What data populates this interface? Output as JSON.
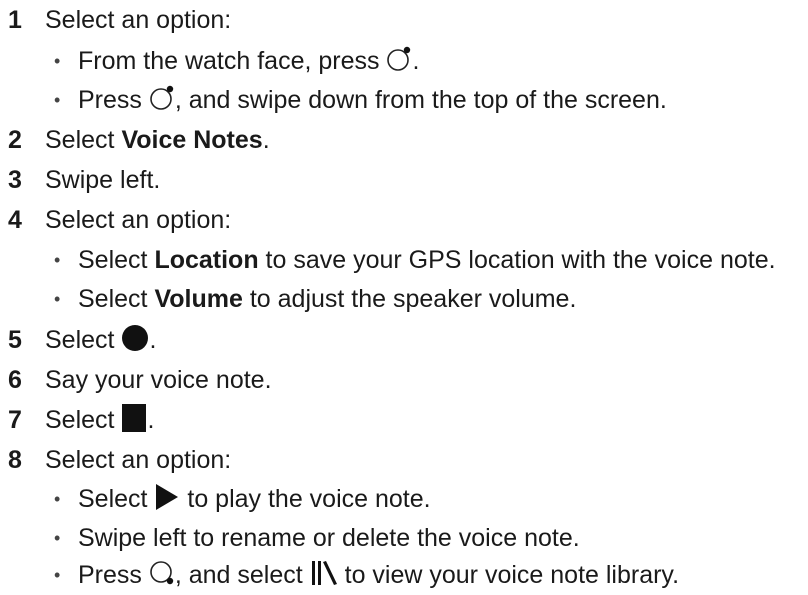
{
  "steps": [
    {
      "number": "1",
      "text": "Select an option:",
      "options": [
        {
          "before": "From the watch face, press ",
          "icon": "watch-button-icon",
          "after": "."
        },
        {
          "before": "Press ",
          "icon": "watch-button-icon",
          "after": ", and swipe down from the top of the screen."
        }
      ]
    },
    {
      "number": "2",
      "before": "Select ",
      "bold": "Voice Notes",
      "after": "."
    },
    {
      "number": "3",
      "text": "Swipe left."
    },
    {
      "number": "4",
      "text": "Select an option:",
      "options": [
        {
          "before": "Select ",
          "bold": "Location",
          "after": " to save your GPS location with the voice note."
        },
        {
          "before": "Select ",
          "bold": "Volume",
          "after": " to adjust the speaker volume."
        }
      ]
    },
    {
      "number": "5",
      "before": "Select ",
      "icon": "record-circle-icon",
      "after": "."
    },
    {
      "number": "6",
      "text": "Say your voice note."
    },
    {
      "number": "7",
      "before": "Select ",
      "icon": "stop-square-icon",
      "after": "."
    },
    {
      "number": "8",
      "text": "Select an option:",
      "options": [
        {
          "before": "Select ",
          "icon": "play-triangle-icon",
          "after": " to play the voice note."
        },
        {
          "text": "Swipe left to rename or delete the voice note."
        },
        {
          "before": "Press ",
          "icon": "watch-lower-button-icon",
          "after": ", and select ",
          "icon2": "library-icon",
          "after2": " to view your voice note library."
        }
      ]
    }
  ],
  "bullet_char": "•"
}
